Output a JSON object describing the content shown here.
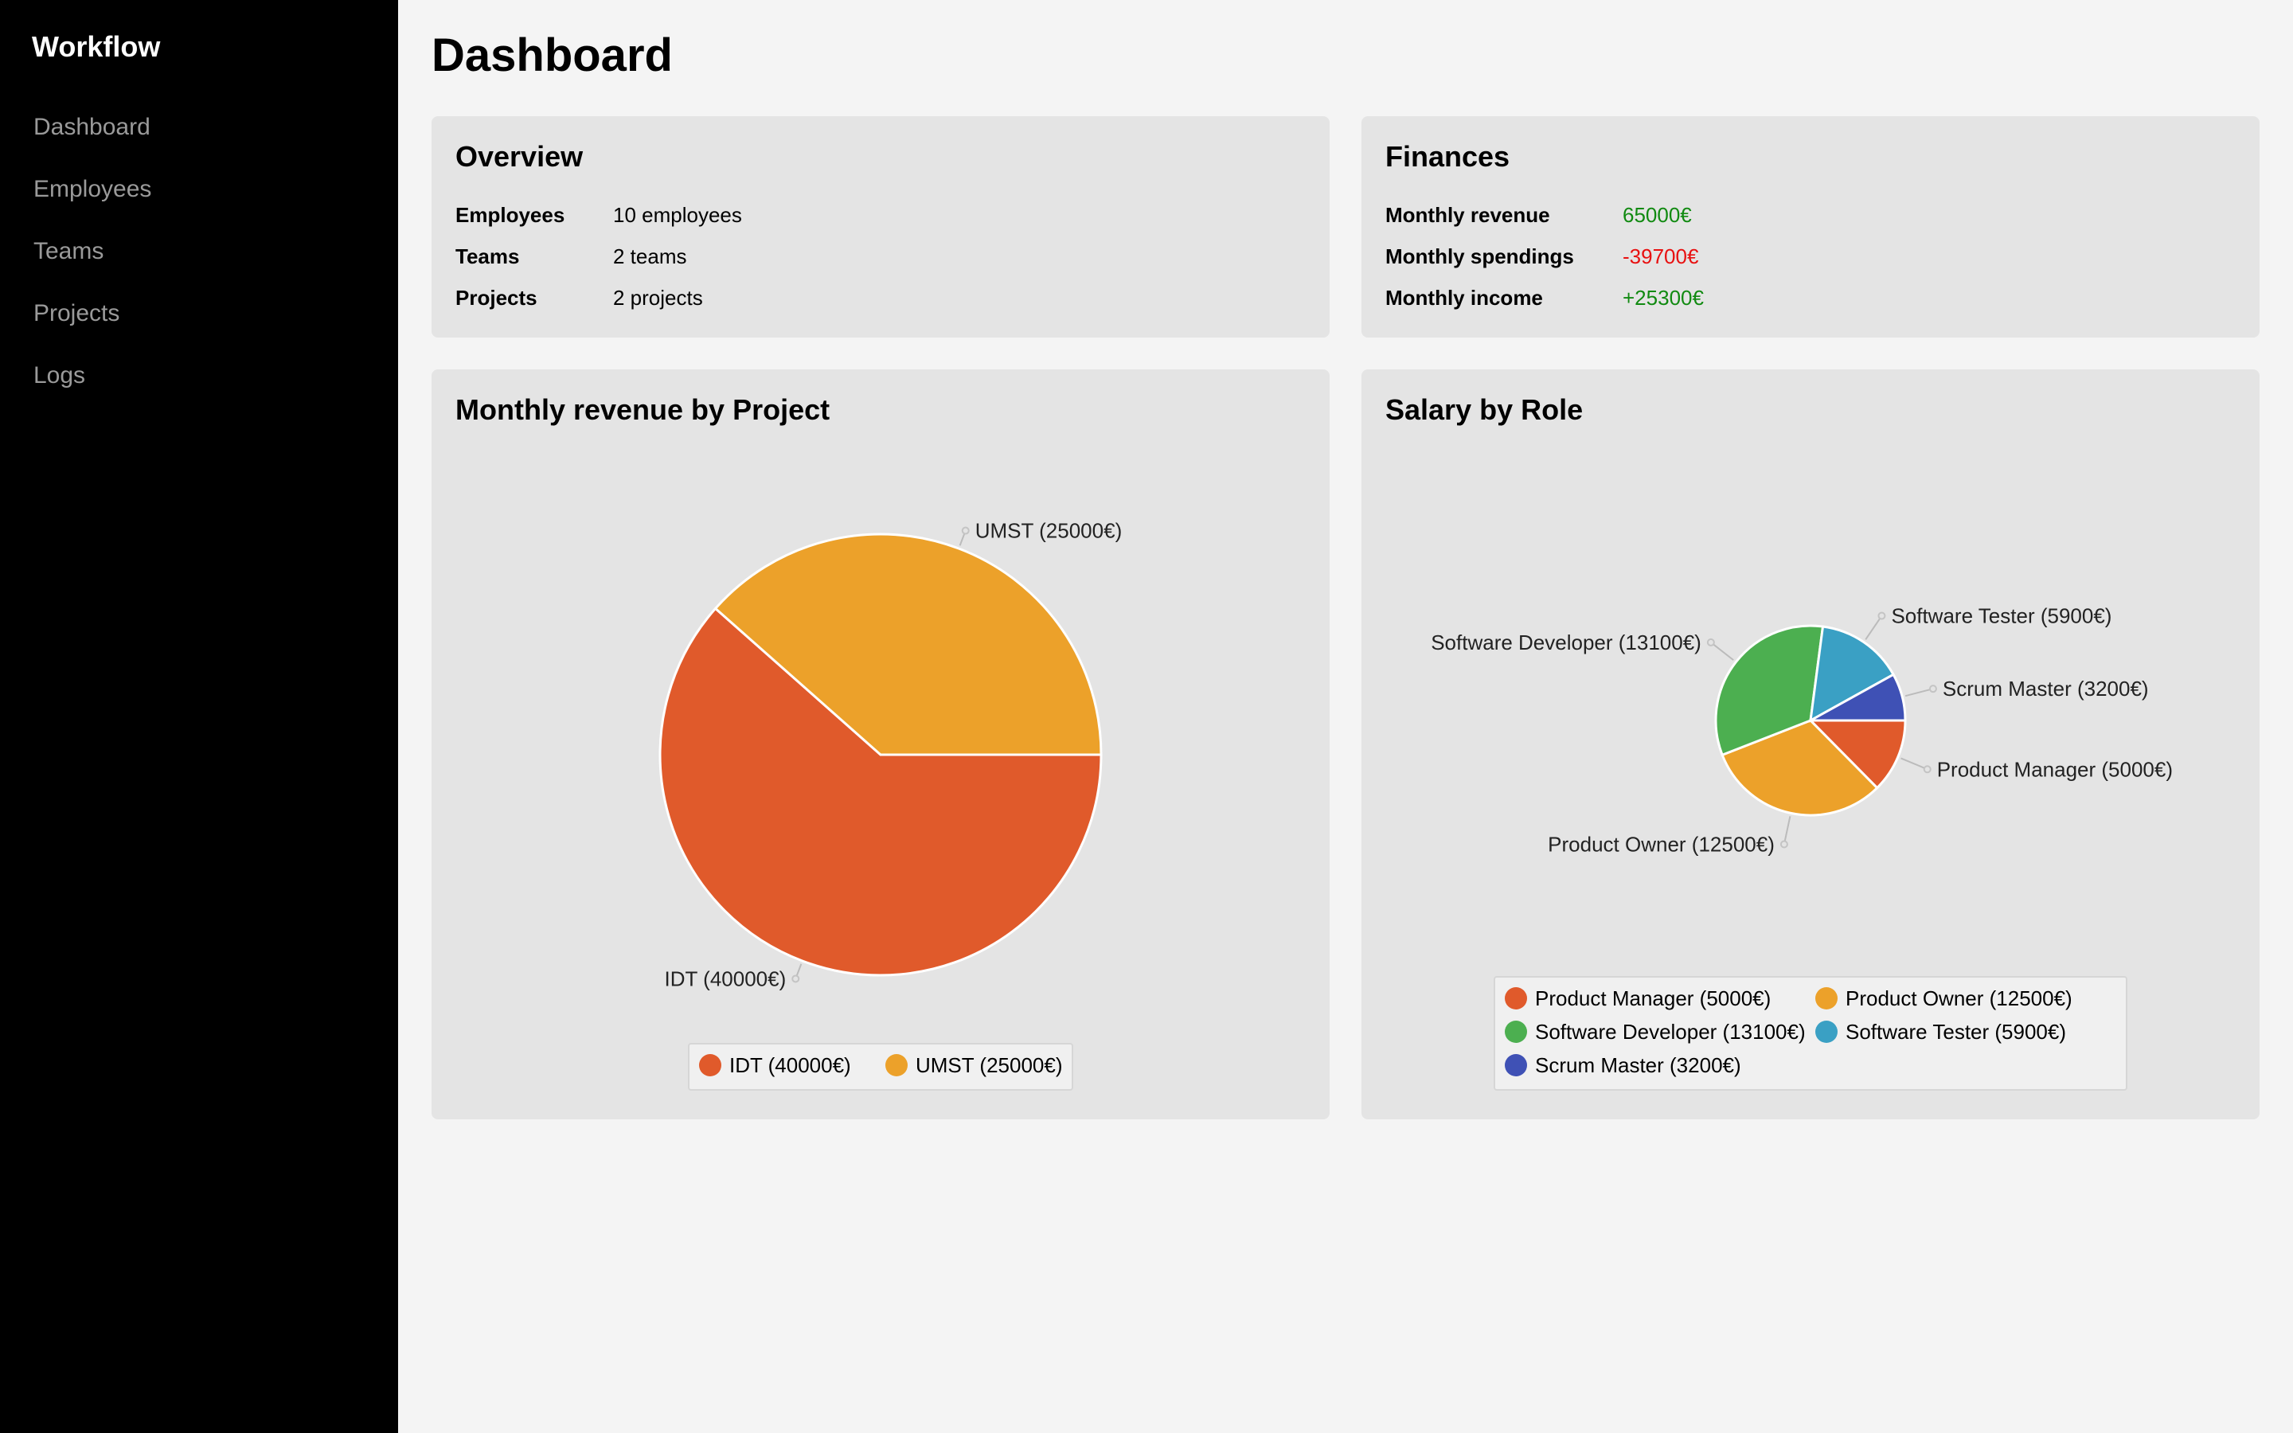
{
  "app": {
    "title": "Workflow"
  },
  "nav": {
    "items": [
      {
        "label": "Dashboard"
      },
      {
        "label": "Employees"
      },
      {
        "label": "Teams"
      },
      {
        "label": "Projects"
      },
      {
        "label": "Logs"
      }
    ]
  },
  "page": {
    "title": "Dashboard"
  },
  "overview": {
    "title": "Overview",
    "rows": [
      {
        "key": "Employees",
        "value": "10 employees"
      },
      {
        "key": "Teams",
        "value": "2 teams"
      },
      {
        "key": "Projects",
        "value": "2 projects"
      }
    ]
  },
  "finances": {
    "title": "Finances",
    "rows": [
      {
        "key": "Monthly revenue",
        "value": "65000€",
        "tone": "positive"
      },
      {
        "key": "Monthly spendings",
        "value": "-39700€",
        "tone": "negative"
      },
      {
        "key": "Monthly income",
        "value": "+25300€",
        "tone": "positive"
      }
    ]
  },
  "colors": {
    "positive": "#118a11",
    "negative": "#e81010",
    "sidebar_bg": "#000000",
    "card_bg": "#e4e4e4"
  },
  "chart_data": [
    {
      "type": "pie",
      "title": "Monthly revenue by Project",
      "legend_position": "bottom",
      "slices": [
        {
          "label": "IDT (40000€)",
          "value": 40000,
          "color": "#e05a2b"
        },
        {
          "label": "UMST (25000€)",
          "value": 25000,
          "color": "#eca12a"
        }
      ]
    },
    {
      "type": "pie",
      "title": "Salary by Role",
      "legend_position": "bottom",
      "slices": [
        {
          "label": "Product Manager (5000€)",
          "value": 5000,
          "color": "#e05a2b"
        },
        {
          "label": "Product Owner (12500€)",
          "value": 12500,
          "color": "#eca12a"
        },
        {
          "label": "Software Developer (13100€)",
          "value": 13100,
          "color": "#4caf50"
        },
        {
          "label": "Software Tester (5900€)",
          "value": 5900,
          "color": "#3aa0c4"
        },
        {
          "label": "Scrum Master (3200€)",
          "value": 3200,
          "color": "#3f51b5"
        }
      ]
    }
  ]
}
